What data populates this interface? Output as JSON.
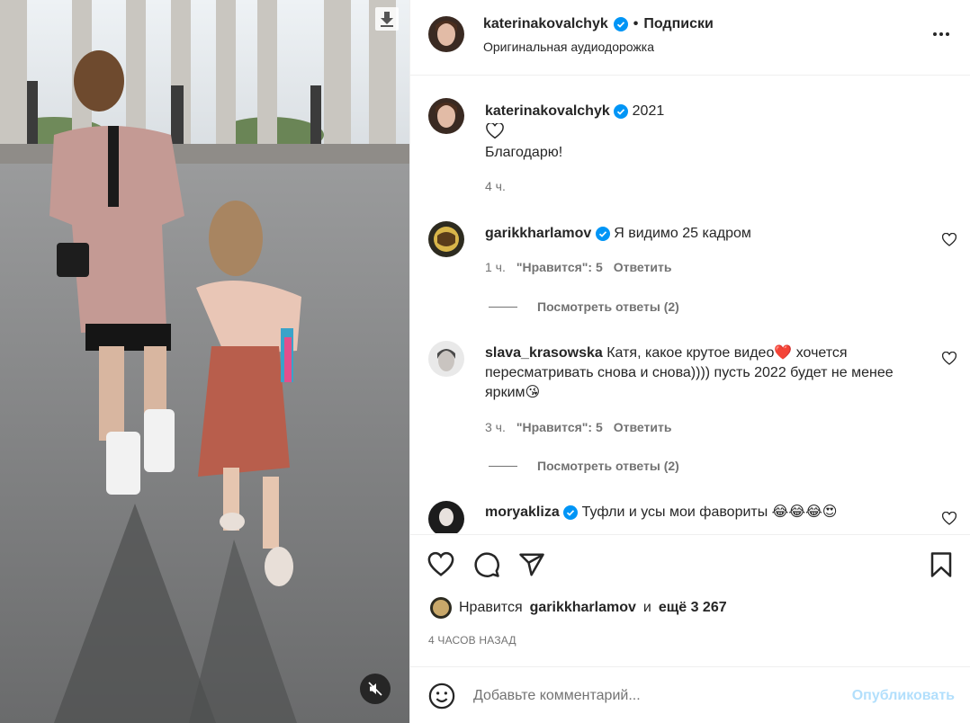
{
  "media": {
    "download_icon": "download-icon",
    "mute_icon": "speaker-muted-icon"
  },
  "header": {
    "username": "katerinakovalchyk",
    "separator": "•",
    "follow_label": "Подписки",
    "audio_label": "Оригинальная аудиодорожка",
    "more_icon": "more-horizontal-icon"
  },
  "caption": {
    "username": "katerinakovalchyk",
    "year": "2021",
    "text": "Благодарю!",
    "time": "4 ч."
  },
  "comments": [
    {
      "username": "garikkharlamov",
      "verified": true,
      "text": "Я видимо 25 кадром",
      "time": "1 ч.",
      "likes": "\"Нравится\": 5",
      "reply": "Ответить",
      "view_replies": "Посмотреть ответы (2)"
    },
    {
      "username": "slava_krasowska",
      "verified": false,
      "text_line1": "Катя, какое крутое видео❤️ хочется",
      "text_line2": "пересматривать снова и снова)))) пусть 2022 будет не менее",
      "text_line3": "ярким😘",
      "time": "3 ч.",
      "likes": "\"Нравится\": 5",
      "reply": "Ответить",
      "view_replies": "Посмотреть ответы (2)"
    },
    {
      "username": "moryakliza",
      "verified": true,
      "text": "Туфли и усы мои фавориты 😂😂😂😍"
    }
  ],
  "actions": {
    "like_icon": "heart-icon",
    "comment_icon": "comment-icon",
    "share_icon": "paper-plane-icon",
    "save_icon": "bookmark-icon"
  },
  "likes": {
    "prefix": "Нравится",
    "user": "garikkharlamov",
    "conj": "и",
    "others": "ещё 3 267"
  },
  "time_ago": "4 ЧАСОВ НАЗАД",
  "comment_form": {
    "placeholder": "Добавьте комментарий...",
    "publish_label": "Опубликовать"
  },
  "colors": {
    "verified": "#0095f6",
    "publish_disabled": "#b2dffc",
    "secondary_text": "#737373"
  }
}
